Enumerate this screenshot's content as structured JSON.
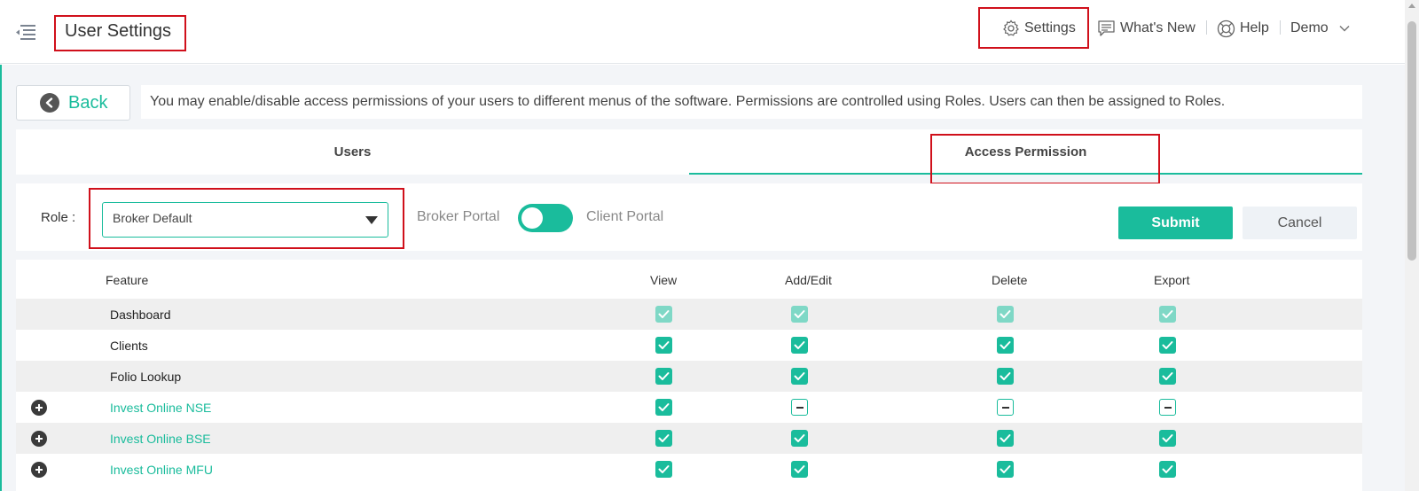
{
  "header": {
    "title": "User Settings",
    "nav": {
      "settings": "Settings",
      "whats_new": "What's New",
      "help": "Help",
      "user": "Demo"
    }
  },
  "toolbar": {
    "back_label": "Back",
    "info_text": "You may enable/disable access permissions of your users to different menus of the software. Permissions are controlled using Roles. Users can then be assigned to Roles."
  },
  "tabs": [
    {
      "label": "Users",
      "active": false
    },
    {
      "label": "Access Permission",
      "active": true
    }
  ],
  "role_bar": {
    "role_label": "Role :",
    "role_value": "Broker Default",
    "broker_portal": "Broker Portal",
    "client_portal": "Client Portal",
    "toggle_on": true,
    "submit_label": "Submit",
    "cancel_label": "Cancel"
  },
  "permissions": {
    "columns": [
      "Feature",
      "View",
      "Add/Edit",
      "Delete",
      "Export"
    ],
    "rows": [
      {
        "feature": "Dashboard",
        "expandable": false,
        "view": "disabled",
        "add_edit": "disabled",
        "delete": "disabled",
        "export": "disabled"
      },
      {
        "feature": "Clients",
        "expandable": false,
        "view": "checked",
        "add_edit": "checked",
        "delete": "checked",
        "export": "checked"
      },
      {
        "feature": "Folio Lookup",
        "expandable": false,
        "view": "checked",
        "add_edit": "checked",
        "delete": "checked",
        "export": "checked"
      },
      {
        "feature": "Invest Online NSE",
        "expandable": true,
        "view": "checked",
        "add_edit": "partial",
        "delete": "partial",
        "export": "partial"
      },
      {
        "feature": "Invest Online BSE",
        "expandable": true,
        "view": "checked",
        "add_edit": "checked",
        "delete": "checked",
        "export": "checked"
      },
      {
        "feature": "Invest Online MFU",
        "expandable": true,
        "view": "checked",
        "add_edit": "checked",
        "delete": "checked",
        "export": "checked"
      }
    ]
  },
  "colors": {
    "accent": "#1abc9c",
    "highlight": "#d0101b"
  }
}
